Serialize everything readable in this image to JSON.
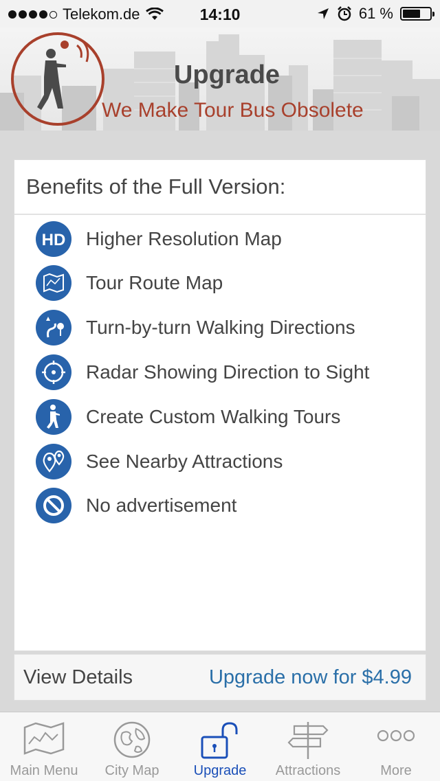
{
  "status_bar": {
    "carrier": "Telekom.de",
    "time": "14:10",
    "battery": "61 %",
    "battery_level": 0.61,
    "signal_bars": 4
  },
  "header": {
    "title": "Upgrade",
    "subtitle": "We Make Tour Bus Obsolete"
  },
  "card": {
    "heading": "Benefits of the Full Version:",
    "benefits": [
      {
        "label": "Higher Resolution Map",
        "icon": "hd-icon"
      },
      {
        "label": "Tour Route Map",
        "icon": "map-icon"
      },
      {
        "label": "Turn-by-turn Walking Directions",
        "icon": "directions-icon"
      },
      {
        "label": "Radar Showing Direction to Sight",
        "icon": "radar-icon"
      },
      {
        "label": "Create Custom Walking Tours",
        "icon": "walker-icon"
      },
      {
        "label": "See Nearby Attractions",
        "icon": "nearby-pins-icon"
      },
      {
        "label": "No advertisement",
        "icon": "no-ads-icon"
      }
    ]
  },
  "footer": {
    "view_details": "View Details",
    "upgrade_now": "Upgrade now for $4.99"
  },
  "tabs": [
    {
      "label": "Main Menu",
      "icon": "folded-map-icon",
      "active": false
    },
    {
      "label": "City Map",
      "icon": "globe-icon",
      "active": false
    },
    {
      "label": "Upgrade",
      "icon": "unlocked-padlock-icon",
      "active": true
    },
    {
      "label": "Attractions",
      "icon": "signpost-icon",
      "active": false
    },
    {
      "label": "More",
      "icon": "more-dots-icon",
      "active": false
    }
  ],
  "colors": {
    "accent_blue": "#2863ab",
    "link_blue": "#2a6fa8",
    "active_tab": "#1a4fb8",
    "brand_red": "#a8402c"
  }
}
